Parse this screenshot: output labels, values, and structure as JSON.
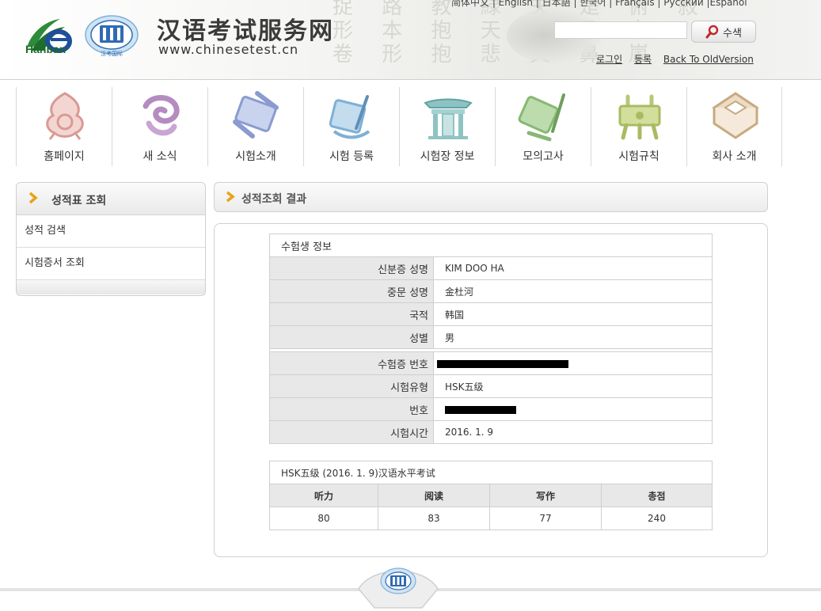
{
  "header": {
    "site_title": "汉语考试服务网",
    "site_url": "www.chinesetest.cn",
    "hanban_logo_text": "Hanban",
    "cti_logo_text": "汉考国际",
    "language_bar": "简体中文 | English | 日本語 | 한국어 | Français | Русский |Español",
    "search": {
      "placeholder": "",
      "button_label": "수색"
    },
    "links": {
      "login": "로그인",
      "register": "등록",
      "old_version": "Back To OldVersion"
    }
  },
  "nav": {
    "items": [
      {
        "label": "홈페이지",
        "icon": "knot-icon"
      },
      {
        "label": "새 소식",
        "icon": "cloud-swirl-icon"
      },
      {
        "label": "시험소개",
        "icon": "scroll-icon"
      },
      {
        "label": "시험 등록",
        "icon": "scroll-brush-icon"
      },
      {
        "label": "시험장 정보",
        "icon": "pavilion-icon"
      },
      {
        "label": "모의고사",
        "icon": "book-brush-icon"
      },
      {
        "label": "시험규칙",
        "icon": "ding-vessel-icon"
      },
      {
        "label": "회사 소개",
        "icon": "cube-icon"
      }
    ]
  },
  "sidebar": {
    "title": "성적표 조회",
    "items": [
      {
        "label": "성적 검색"
      },
      {
        "label": "시험증서 조회"
      }
    ]
  },
  "main": {
    "title": "성적조회 결과",
    "candidate": {
      "caption": "수험생 정보",
      "rows_personal": [
        {
          "label": "신분증 성명",
          "value": "KIM DOO HA"
        },
        {
          "label": "중문 성명",
          "value": "金杜河"
        },
        {
          "label": "국적",
          "value": "韩国"
        },
        {
          "label": "성별",
          "value": "男"
        }
      ],
      "rows_exam": [
        {
          "label": "수험증 번호",
          "value": "",
          "redacted": true
        },
        {
          "label": "시험유형",
          "value": "HSK五级"
        },
        {
          "label": "번호",
          "value": "",
          "redacted": true
        },
        {
          "label": "시험시간",
          "value": "2016. 1. 9"
        }
      ]
    },
    "scores": {
      "caption": "HSK五级 (2016. 1. 9)汉语水平考试",
      "columns": [
        "听力",
        "阅读",
        "写作",
        "총점"
      ],
      "values": [
        "80",
        "83",
        "77",
        "240"
      ]
    }
  },
  "colors": {
    "accent_chevron": "#e8a317",
    "header_bg": "#eeeeec",
    "table_label_bg": "#e8e8e8",
    "border": "#cfcfcf"
  }
}
